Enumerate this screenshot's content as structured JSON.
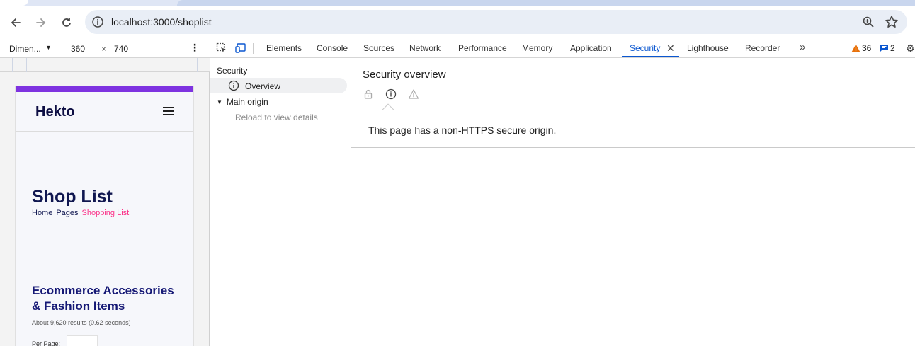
{
  "browser": {
    "url": "localhost:3000/shoplist"
  },
  "device_toolbar": {
    "device": "Dimen...",
    "width": "360",
    "times": "×",
    "height": "740"
  },
  "emulated_page": {
    "logo": "Hekto",
    "page_title": "Shop List",
    "breadcrumbs": [
      "Home",
      "Pages",
      "Shopping List"
    ],
    "section_title": "Ecommerce Accessories & Fashion Items",
    "results": "About 9,620 results (0.62 seconds)",
    "per_page_label": "Per Page:",
    "accent_color": "#fb2e86",
    "top_strip_color": "#7e33e0"
  },
  "devtools": {
    "tabs": [
      "Elements",
      "Console",
      "Sources",
      "Network",
      "Performance",
      "Memory",
      "Application",
      "Security",
      "Lighthouse",
      "Recorder"
    ],
    "active_tab": "Security",
    "warnings_count": "36",
    "messages_count": "2",
    "security": {
      "sidebar_title": "Security",
      "overview_label": "Overview",
      "main_origin_label": "Main origin",
      "reload_hint": "Reload to view details",
      "overview_title": "Security overview",
      "message": "This page has a non-HTTPS secure origin."
    }
  }
}
